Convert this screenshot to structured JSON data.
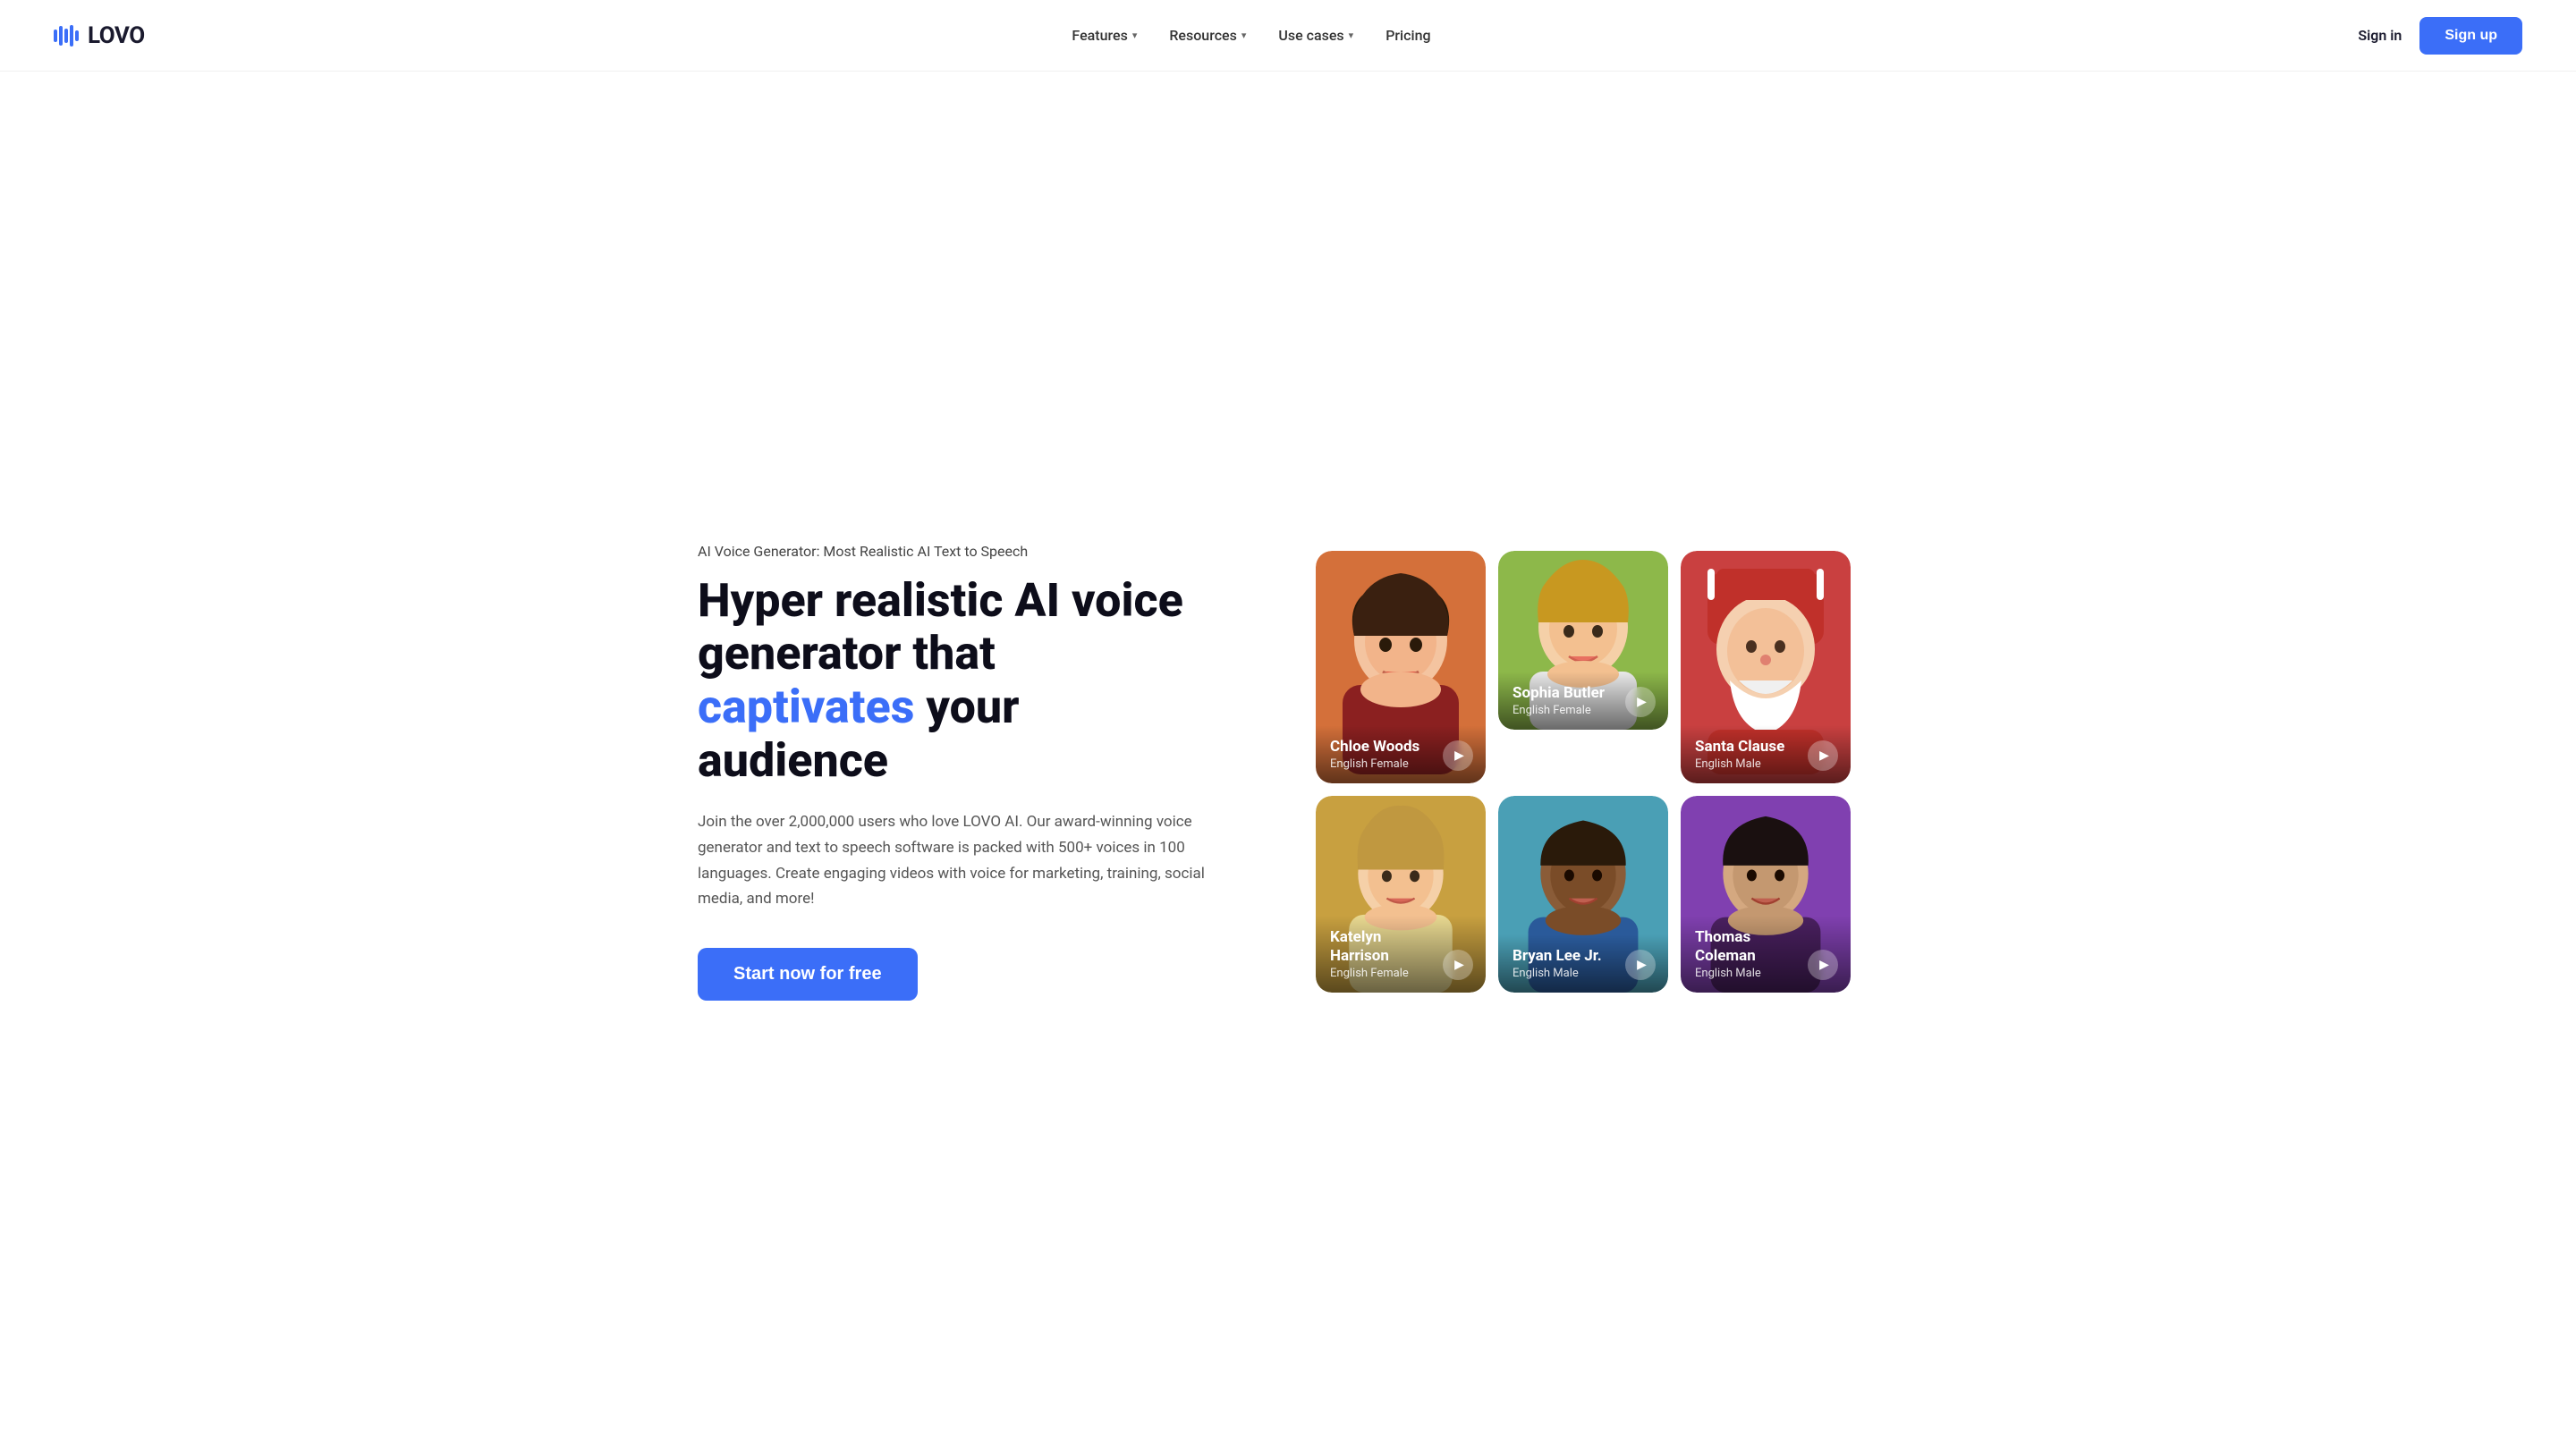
{
  "logo": {
    "text": "LOVO"
  },
  "nav": {
    "items": [
      {
        "label": "Features",
        "has_dropdown": true
      },
      {
        "label": "Resources",
        "has_dropdown": true
      },
      {
        "label": "Use cases",
        "has_dropdown": true
      },
      {
        "label": "Pricing",
        "has_dropdown": false
      }
    ],
    "signin_label": "Sign in",
    "signup_label": "Sign up"
  },
  "hero": {
    "subtitle": "AI Voice Generator: Most Realistic AI Text to Speech",
    "title_part1": "Hyper realistic AI voice generator that ",
    "title_accent": "captivates",
    "title_part2": " your audience",
    "description": "Join the over 2,000,000 users who love LOVO AI. Our award-winning voice generator and text to speech software is packed with 500+ voices in 100 languages. Create engaging videos with voice for marketing, training, social media, and more!",
    "cta_label": "Start now for free"
  },
  "voices": [
    {
      "name": "Chloe Woods",
      "lang": "English Female",
      "bg_color": "#d4703a",
      "position": "tall"
    },
    {
      "name": "Sophia Butler",
      "lang": "English Female",
      "bg_color": "#8db84a",
      "position": "short"
    },
    {
      "name": "Santa Clause",
      "lang": "English Male",
      "bg_color": "#c94040",
      "position": "tall"
    },
    {
      "name": "Katelyn Harrison",
      "lang": "English Female",
      "bg_color": "#c8a040",
      "position": "normal"
    },
    {
      "name": "Bryan Lee Jr.",
      "lang": "English Male",
      "bg_color": "#4a9fb5",
      "position": "normal"
    },
    {
      "name": "Thomas Coleman",
      "lang": "English Male",
      "bg_color": "#8040b0",
      "position": "normal"
    }
  ]
}
